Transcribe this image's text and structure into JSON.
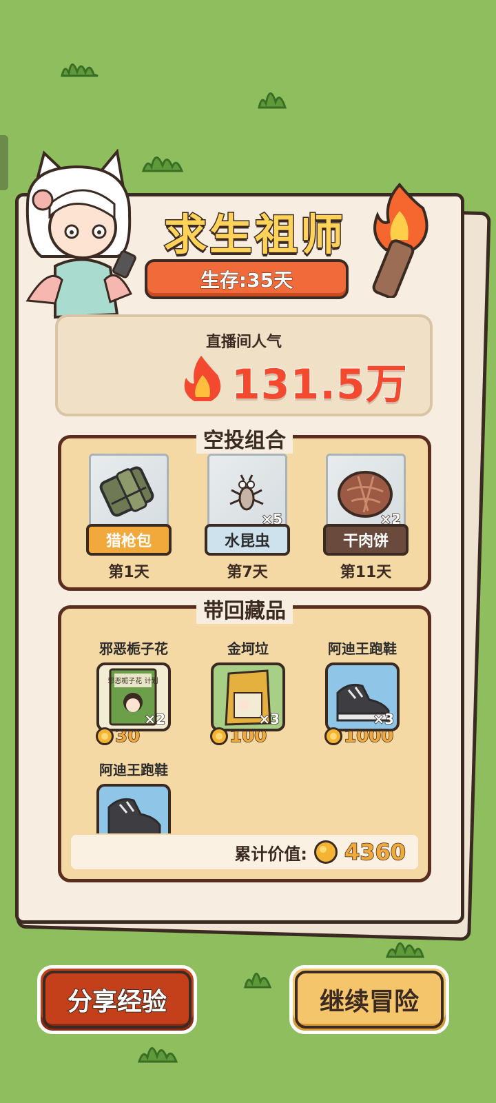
{
  "game": {
    "title": "求生祖师",
    "survival_text": "生存:35天",
    "popularity_label": "直播间人气",
    "popularity_value": "131.5万"
  },
  "airdrop": {
    "title": "空投组合",
    "items": [
      {
        "name": "猎枪包",
        "day": "第1天",
        "qty": ""
      },
      {
        "name": "水昆虫",
        "day": "第7天",
        "qty": "×5"
      },
      {
        "name": "干肉饼",
        "day": "第11天",
        "qty": "×2"
      }
    ]
  },
  "collection": {
    "title": "带回藏品",
    "items": [
      {
        "name": "邪恶栀子花",
        "qty": "×2",
        "price": "30"
      },
      {
        "name": "金坷垃",
        "qty": "×3",
        "price": "100"
      },
      {
        "name": "阿迪王跑鞋",
        "qty": "×3",
        "price": "1000"
      },
      {
        "name": "阿迪王跑鞋",
        "qty": "",
        "price": ""
      }
    ],
    "total_label": "累计价值:",
    "total_value": "4360"
  },
  "buttons": {
    "share": "分享经验",
    "continue": "继续冒险"
  },
  "book_cover_text": "邪恶栀子花 计划",
  "colors": {
    "background": "#8fbe5e",
    "paper": "#f7ede0",
    "accent_red": "#f34a2f",
    "accent_orange": "#f06a3a",
    "gold": "#f0a93a",
    "outline": "#3b2a21"
  }
}
